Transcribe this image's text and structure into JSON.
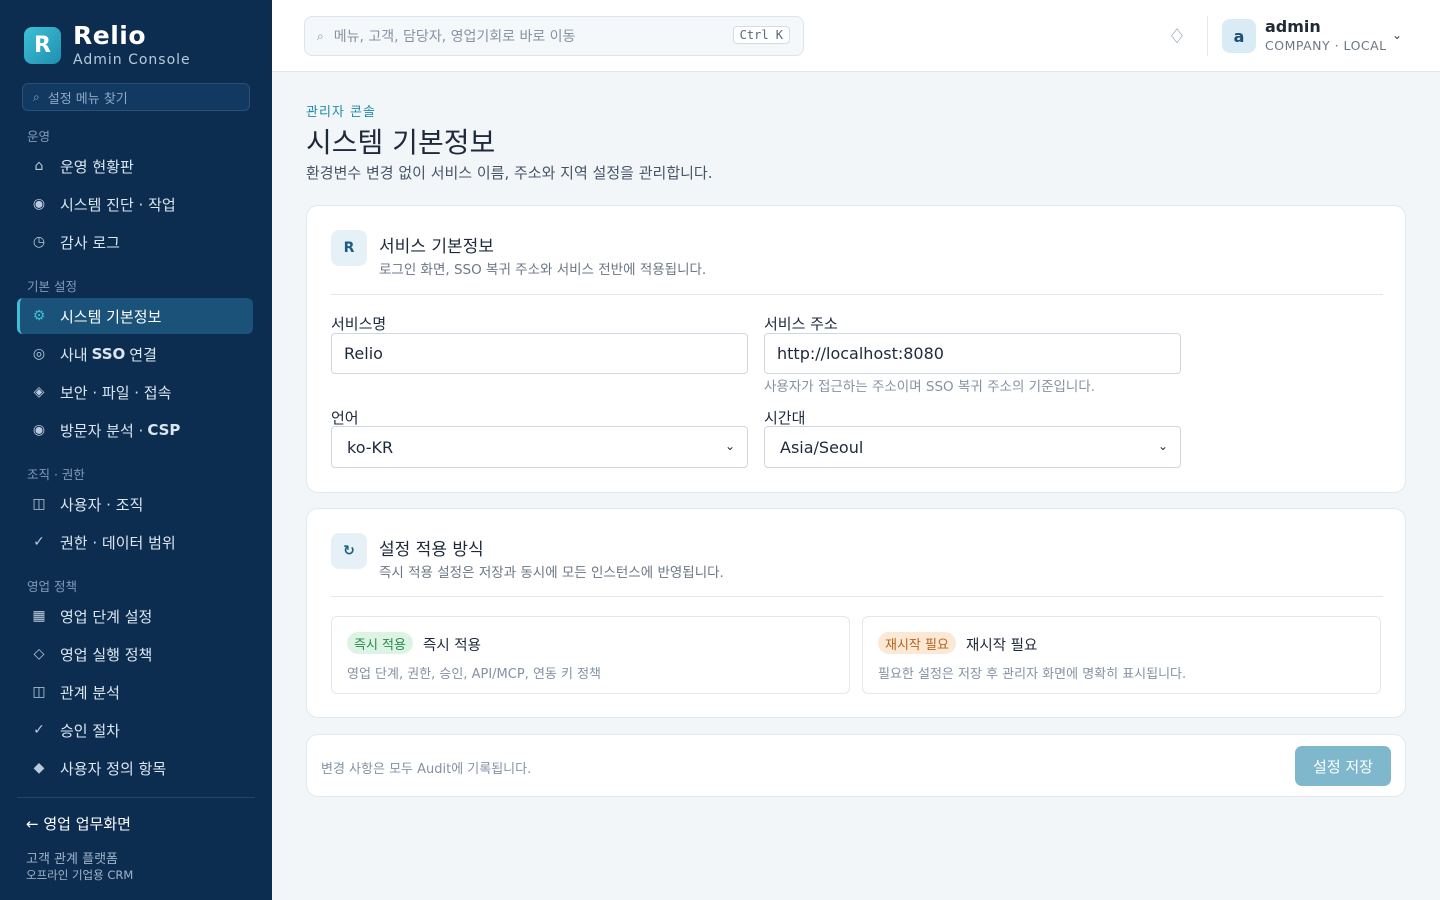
{
  "brand": {
    "logo_letter": "R",
    "name": "Relio",
    "sub": "Admin Console"
  },
  "sidebar": {
    "search_placeholder": "설정 메뉴 찾기",
    "groups": [
      {
        "label": "운영",
        "items": [
          {
            "icon": "home-icon",
            "glyph": "⌂",
            "label": "운영 현황판"
          },
          {
            "icon": "pulse-icon",
            "glyph": "◉",
            "label": "시스템 진단 · 작업"
          },
          {
            "icon": "clock-icon",
            "glyph": "◷",
            "label": "감사 로그"
          }
        ]
      },
      {
        "label": "기본 설정",
        "items": [
          {
            "icon": "gear-icon",
            "glyph": "⚙",
            "label": "시스템 기본정보",
            "active": true
          },
          {
            "icon": "target-icon",
            "glyph": "◎",
            "label_pre": "사내",
            "label_bold": "SSO",
            "label_post": "연결"
          },
          {
            "icon": "diamond-icon",
            "glyph": "◈",
            "label": "보안 · 파일 · 접속"
          },
          {
            "icon": "eye-icon",
            "glyph": "◉",
            "label_pre": "방문자 분석 ·",
            "label_bold": "CSP",
            "label_post": ""
          }
        ]
      },
      {
        "label": "조직 · 권한",
        "items": [
          {
            "icon": "users-icon",
            "glyph": "◫",
            "label": "사용자 · 조직"
          },
          {
            "icon": "check-icon",
            "glyph": "✓",
            "label": "권한 · 데이터 범위"
          }
        ]
      },
      {
        "label": "영업 정책",
        "items": [
          {
            "icon": "grid-icon",
            "glyph": "▦",
            "label": "영업 단계 설정"
          },
          {
            "icon": "diamond-outline-icon",
            "glyph": "◇",
            "label": "영업 실행 정책"
          },
          {
            "icon": "network-icon",
            "glyph": "◫",
            "label": "관계 분석"
          },
          {
            "icon": "check-icon",
            "glyph": "✓",
            "label": "승인 절차"
          },
          {
            "icon": "diamond-solid-icon",
            "glyph": "◆",
            "label": "사용자 정의 항목"
          }
        ]
      }
    ],
    "back_link": "← 영업 업무화면",
    "footer_line1": "고객 관계 플랫폼",
    "footer_line2": "오프라인 기업용 CRM"
  },
  "topbar": {
    "search_placeholder": "메뉴, 고객, 담당자, 영업기회로 바로 이동",
    "shortcut": "Ctrl K",
    "bell_glyph": "♢",
    "user": {
      "avatar_letter": "a",
      "name": "admin",
      "meta": "COMPANY · LOCAL"
    }
  },
  "page": {
    "breadcrumb": "관리자 콘솔",
    "title": "시스템 기본정보",
    "description": "환경변수 변경 없이 서비스 이름, 주소와 지역 설정을 관리합니다."
  },
  "service_card": {
    "icon_letter": "R",
    "title": "서비스 기본정보",
    "subtitle": "로그인 화면, SSO 복귀 주소와 서비스 전반에 적용됩니다.",
    "fields": {
      "name_label": "서비스명",
      "name_value": "Relio",
      "url_label": "서비스 주소",
      "url_value": "http://localhost:8080",
      "url_help": "사용자가 접근하는 주소이며 SSO 복귀 주소의 기준입니다.",
      "lang_label": "언어",
      "lang_value": "ko-KR",
      "tz_label": "시간대",
      "tz_value": "Asia/Seoul"
    }
  },
  "apply_card": {
    "icon_glyph": "↻",
    "title": "설정 적용 방식",
    "subtitle": "즉시 적용 설정은 저장과 동시에 모든 인스턴스에 반영됩니다.",
    "options": [
      {
        "badge": "즉시 적용",
        "title": "즉시 적용",
        "desc": "영업 단계, 권한, 승인, API/MCP, 연동 키 정책",
        "color": "#2d8a4e"
      },
      {
        "badge": "재시작 필요",
        "title": "재시작 필요",
        "desc": "필요한 설정은 저장 후 관리자 화면에 명확히 표시됩니다.",
        "color": "#b8621d"
      }
    ]
  },
  "save_bar": {
    "note": "변경 사항은 모두 Audit에 기록됩니다.",
    "button": "설정 저장"
  },
  "colors": {
    "sidebar_bg": "#0d2d50",
    "accent": "#3fc0d6",
    "save_button": "#7fb7cd"
  }
}
